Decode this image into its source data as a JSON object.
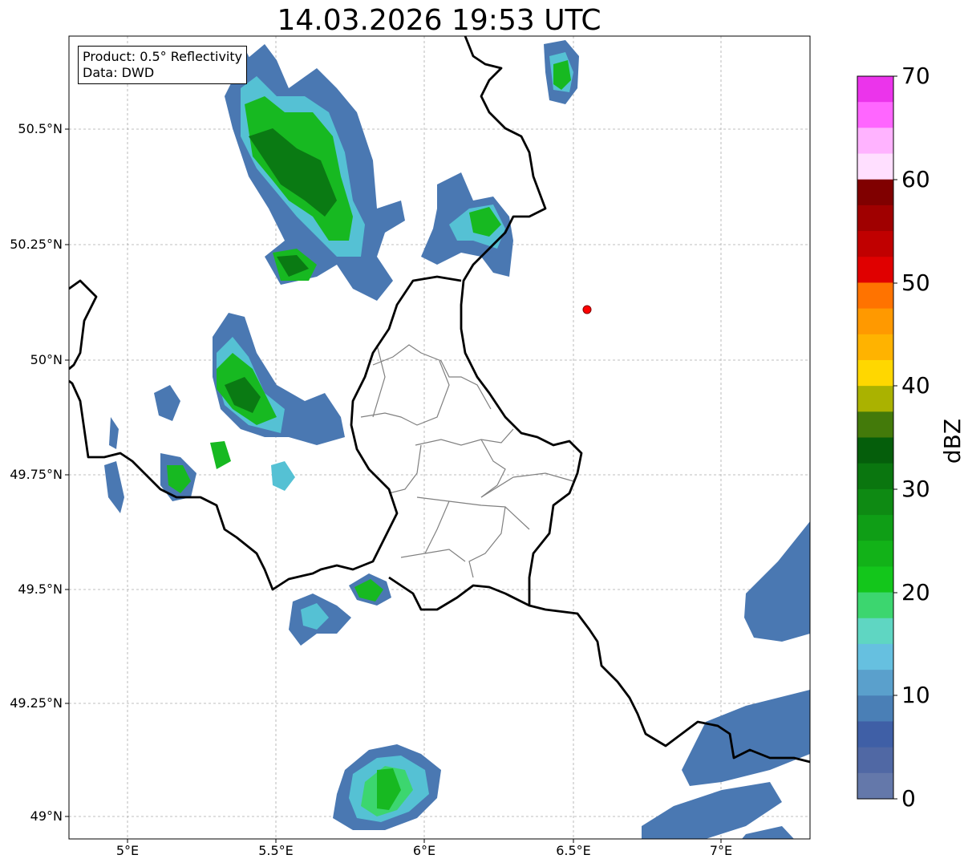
{
  "title": "14.03.2026 19:53 UTC",
  "info": {
    "product": "Product: 0.5° Reflectivity",
    "data": "Data: DWD"
  },
  "axes": {
    "y_ticks": [
      "50.5°N",
      "50.25°N",
      "50°N",
      "49.75°N",
      "49.5°N",
      "49.25°N",
      "49°N"
    ],
    "x_ticks": [
      "5°E",
      "5.5°E",
      "6°E",
      "6.5°E",
      "7°E"
    ]
  },
  "colorbar": {
    "label": "dBZ",
    "ticks": [
      "70",
      "60",
      "50",
      "40",
      "30",
      "20",
      "10",
      "0"
    ],
    "colors": [
      "#eb34eb",
      "#ff66ff",
      "#ffb3ff",
      "#ffdfff",
      "#800000",
      "#a00000",
      "#c00000",
      "#e00000",
      "#ff7300",
      "#ff9900",
      "#ffb300",
      "#ffd700",
      "#aab200",
      "#437a0a",
      "#055e0b",
      "#0a760f",
      "#0e8a13",
      "#0f9e16",
      "#12b218",
      "#13c61b",
      "#3cd66f",
      "#5fd6c2",
      "#66c0e0",
      "#5aa0cc",
      "#4a7fb6",
      "#3f5fa6",
      "#5068a4",
      "#6478aa"
    ]
  },
  "map": {
    "station_marker": "red-dot",
    "gridlines": true
  }
}
